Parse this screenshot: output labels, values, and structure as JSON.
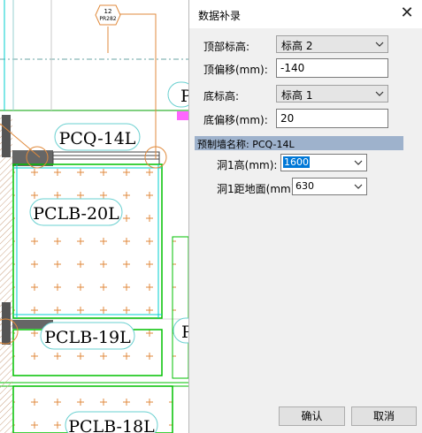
{
  "drawing": {
    "axis_bubble": {
      "number": "12",
      "code": "PR282"
    },
    "labels": {
      "pcq": "PCQ-14L",
      "pclb20": "PCLB-20L",
      "pclb19": "PCLB-19L",
      "pclb18": "PCLB-18L",
      "partial_p1": "P",
      "partial_p2": "P"
    }
  },
  "dialog": {
    "title": "数据补录",
    "close_icon": "close-icon",
    "top_level": {
      "label": "顶部标高:",
      "value": "标高 2"
    },
    "top_offset": {
      "label": "顶偏移(mm):",
      "value": "-140"
    },
    "bottom_level": {
      "label": "底标高:",
      "value": "标高 1"
    },
    "bottom_offset": {
      "label": "底偏移(mm):",
      "value": "20"
    },
    "section_title": "预制墙名称: PCQ-14L",
    "hole_height": {
      "label": "洞1高(mm):",
      "value": "1600"
    },
    "hole_floor": {
      "label": "洞1距地面(mm):",
      "value": "630"
    },
    "ok": "确认",
    "cancel": "取消"
  }
}
